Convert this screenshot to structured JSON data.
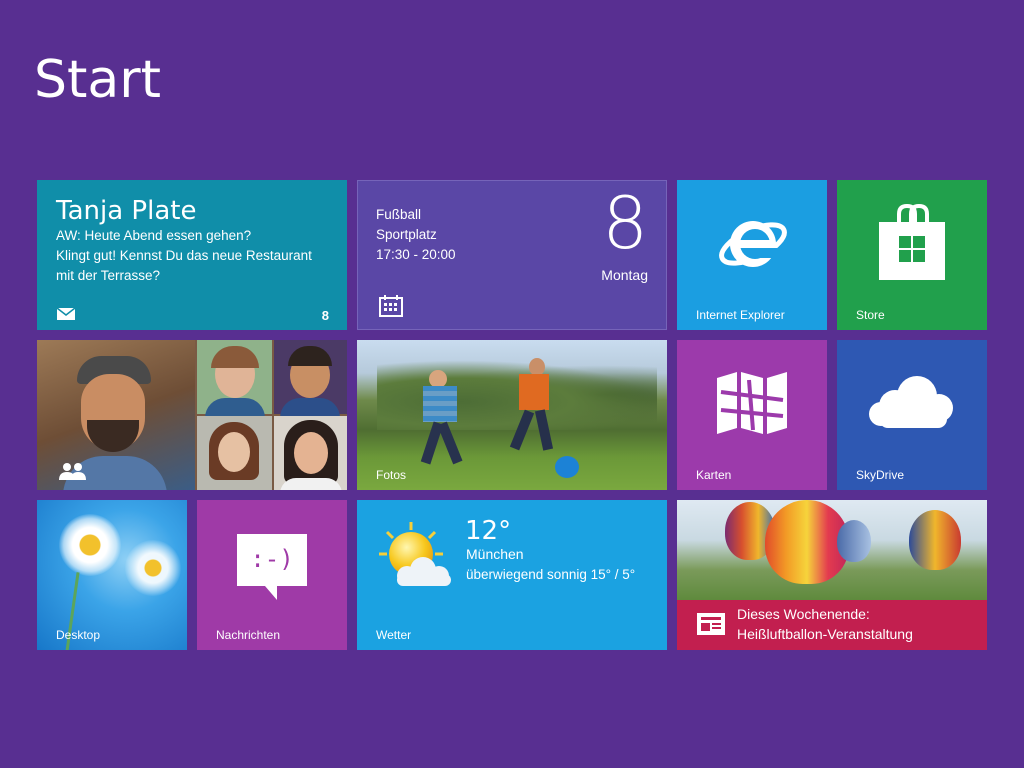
{
  "screen": {
    "title": "Start"
  },
  "colors": {
    "background": "#582f91",
    "mail": "#108ea9",
    "calendar": "#5a47a6",
    "ie": "#1b9ee1",
    "store": "#21a04c",
    "maps": "#9c3aab",
    "skydrive": "#2e58b3",
    "messages": "#9f3aa7",
    "weather": "#1ba2e1",
    "news_bar": "#c21f4f"
  },
  "tiles": {
    "mail": {
      "sender": "Tanja Plate",
      "lines": [
        "AW: Heute Abend essen gehen?",
        "Klingt gut! Kennst Du das neue Restaurant",
        "mit der Terrasse?"
      ],
      "count": "8",
      "icon": "envelope-icon"
    },
    "calendar": {
      "events": [
        "Fußball",
        "Sportplatz",
        "17:30 - 20:00"
      ],
      "day_number": "8",
      "day_name": "Montag",
      "icon": "calendar-icon"
    },
    "ie": {
      "label": "Internet Explorer",
      "icon": "internet-explorer-icon"
    },
    "store": {
      "label": "Store",
      "icon": "store-bag-icon"
    },
    "people": {
      "icon": "people-icon"
    },
    "photos": {
      "label": "Fotos"
    },
    "maps": {
      "label": "Karten",
      "icon": "map-icon"
    },
    "skydrive": {
      "label": "SkyDrive",
      "icon": "cloud-icon"
    },
    "desktop": {
      "label": "Desktop"
    },
    "messages": {
      "label": "Nachrichten",
      "bubble_text": ":-)",
      "icon": "speech-bubble-icon"
    },
    "weather": {
      "label": "Wetter",
      "temp": "12°",
      "city": "München",
      "condition": "überwiegend sonnig 15° / 5°",
      "icon": "sun-cloud-icon"
    },
    "news": {
      "headline": [
        "Dieses Wochenende:",
        "Heißluftballon-Veranstaltung"
      ],
      "icon": "newspaper-icon"
    }
  }
}
